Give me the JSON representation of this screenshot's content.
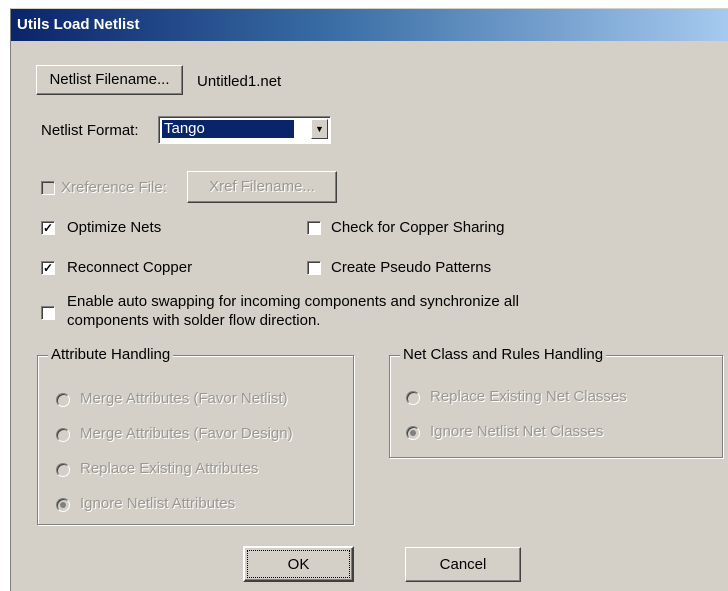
{
  "window": {
    "title": "Utils Load Netlist"
  },
  "netlist": {
    "button_label": "Netlist Filename...",
    "filename": "Untitled1.net"
  },
  "format": {
    "label": "Netlist Format:",
    "value": "Tango"
  },
  "xref": {
    "label": "Xreference File:",
    "button_label": "Xref Filename...",
    "enabled": false
  },
  "options": {
    "optimize_nets": {
      "label": "Optimize Nets",
      "checked": true
    },
    "check_copper_sharing": {
      "label": "Check for Copper Sharing",
      "checked": false
    },
    "reconnect_copper": {
      "label": "Reconnect Copper",
      "checked": true
    },
    "create_pseudo_patterns": {
      "label": "Create Pseudo Patterns",
      "checked": false
    },
    "auto_swapping": {
      "label_line1": "Enable auto swapping for incoming components and synchronize all",
      "label_line2": "components with solder flow direction.",
      "checked": false
    }
  },
  "attribute_handling": {
    "title": "Attribute Handling",
    "options": [
      {
        "label": "Merge Attributes (Favor Netlist)",
        "selected": false
      },
      {
        "label": "Merge Attributes (Favor Design)",
        "selected": false
      },
      {
        "label": "Replace Existing Attributes",
        "selected": false
      },
      {
        "label": "Ignore Netlist Attributes",
        "selected": true
      }
    ]
  },
  "net_class_handling": {
    "title": "Net Class and Rules Handling",
    "options": [
      {
        "label": "Replace Existing Net Classes",
        "selected": false
      },
      {
        "label": "Ignore Netlist Net Classes",
        "selected": true
      }
    ]
  },
  "footer": {
    "ok_label": "OK",
    "cancel_label": "Cancel"
  }
}
